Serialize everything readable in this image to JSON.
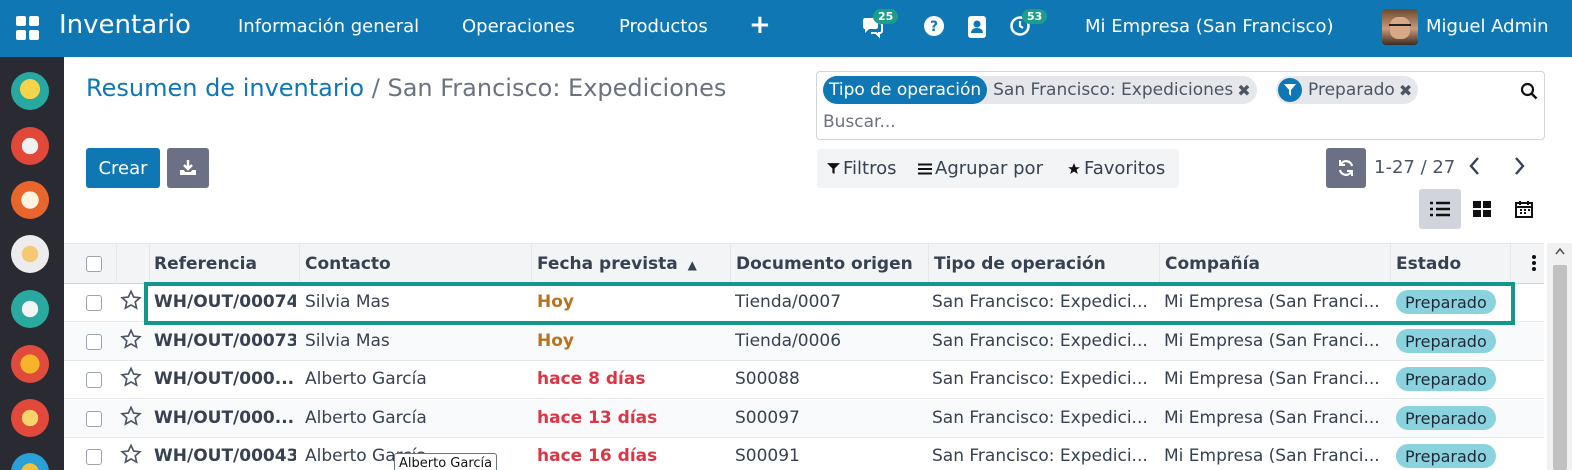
{
  "topbar": {
    "app_name": "Inventario",
    "menu": [
      "Información general",
      "Operaciones",
      "Productos"
    ],
    "plus": "+",
    "chat_count": "25",
    "activity_count": "53",
    "company": "Mi Empresa (San Francisco)",
    "user": "Miguel Admin"
  },
  "breadcrumb": {
    "parent": "Resumen de inventario",
    "separator": "/",
    "current": "San Francisco: Expediciones"
  },
  "actions": {
    "create": "Crear"
  },
  "search": {
    "facet1_title": "Tipo de operación",
    "facet1_value": "San Francisco: Expediciones",
    "facet2_value": "Preparado",
    "remove": "✖",
    "placeholder": "Buscar..."
  },
  "filters": {
    "filters_label": "Filtros",
    "group_label": "Agrupar por",
    "favorites_label": "Favoritos"
  },
  "pager": {
    "range": "1-27 / 27"
  },
  "table": {
    "columns": [
      "Referencia",
      "Contacto",
      "Fecha prevista",
      "Documento origen",
      "Tipo de operación",
      "Compañía",
      "Estado"
    ],
    "sort_indicator": "▲",
    "rows": [
      {
        "ref": "WH/OUT/00074",
        "contact": "Silvia Mas",
        "date": "Hoy",
        "date_kind": "today",
        "origin": "Tienda/0007",
        "op_type": "San Francisco: Expedici...",
        "company": "Mi Empresa (San Franci...",
        "state": "Preparado"
      },
      {
        "ref": "WH/OUT/00073",
        "contact": "Silvia Mas",
        "date": "Hoy",
        "date_kind": "today",
        "origin": "Tienda/0006",
        "op_type": "San Francisco: Expedici...",
        "company": "Mi Empresa (San Franci...",
        "state": "Preparado"
      },
      {
        "ref": "WH/OUT/000...",
        "contact": "Alberto García",
        "date": "hace 8 días",
        "date_kind": "late",
        "origin": "S00088",
        "op_type": "San Francisco: Expedici...",
        "company": "Mi Empresa (San Franci...",
        "state": "Preparado"
      },
      {
        "ref": "WH/OUT/000...",
        "contact": "Alberto García",
        "date": "hace 13 días",
        "date_kind": "late",
        "origin": "S00097",
        "op_type": "San Francisco: Expedici...",
        "company": "Mi Empresa (San Franci...",
        "state": "Preparado"
      },
      {
        "ref": "WH/OUT/00043",
        "contact": "Alberto García",
        "date": "hace 16 días",
        "date_kind": "late",
        "origin": "S00091",
        "op_type": "San Francisco: Expedici...",
        "company": "Mi Empresa (San Franci...",
        "state": "Preparado"
      }
    ]
  },
  "tooltip": "Alberto García",
  "colors": {
    "brand": "#0f78b4",
    "highlight": "#14968a",
    "state_badge": "#89d2de",
    "today": "#b7741f",
    "late": "#dc3545"
  }
}
